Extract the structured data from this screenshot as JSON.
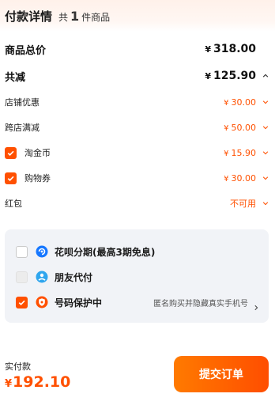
{
  "header": {
    "title": "付款详情",
    "count_prefix": "共",
    "count": "1",
    "count_suffix": "件商品"
  },
  "summary": {
    "total_label": "商品总价",
    "total_currency": "¥",
    "total_value": "318.00",
    "discount_label": "共减",
    "discount_currency": "¥",
    "discount_value": "125.90"
  },
  "discounts": [
    {
      "label": "店铺优惠",
      "currency": "¥",
      "value": "30.00"
    },
    {
      "label": "跨店满减",
      "currency": "¥",
      "value": "50.00"
    },
    {
      "label": "淘金币",
      "currency": "¥",
      "value": "15.90",
      "checked": true
    },
    {
      "label": "购物券",
      "currency": "¥",
      "value": "30.00",
      "checked": true
    },
    {
      "label": "红包",
      "value": "不可用"
    }
  ],
  "options": [
    {
      "label": "花呗分期(最高3期免息)",
      "checked": false,
      "icon": "huabei-icon"
    },
    {
      "label": "朋友代付",
      "checked": false,
      "disabled": true,
      "icon": "friend-pay-icon"
    },
    {
      "label": "号码保护中",
      "checked": true,
      "icon": "phone-shield-icon",
      "note": "匿名购买并隐藏真实手机号"
    }
  ],
  "footer": {
    "paid_label": "实付款",
    "currency": "¥",
    "paid_value": "192.10",
    "submit_label": "提交订单"
  },
  "colors": {
    "accent": "#ff5000",
    "panel": "#f1f3f7"
  }
}
